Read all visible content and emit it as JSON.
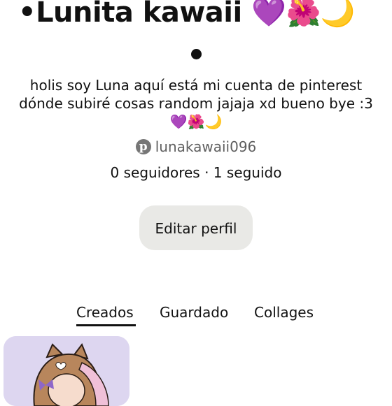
{
  "profile": {
    "display_name": "•Lunita kawaii 💜🌺🌙",
    "bio_line_1": "holis soy Luna aquí está mi cuenta de pinterest",
    "bio_line_2": "dónde subiré cosas random  jajaja xd bueno bye :3",
    "bio_line_3": "💜🌺🌙",
    "username": "lunakawaii096",
    "stats": "0 seguidores · 1 seguido",
    "edit_button_label": "Editar perfil"
  },
  "tabs": [
    {
      "label": "Creados",
      "active": true
    },
    {
      "label": "Guardado",
      "active": false
    },
    {
      "label": "Collages",
      "active": false
    }
  ],
  "colors": {
    "accent": "#111111",
    "secondary_text": "#5f5f5f",
    "button_bg": "#e9e9e6",
    "card_bg": "#ddd6f0"
  },
  "icons": {
    "handle_icon": "pinterest-logo-icon"
  }
}
